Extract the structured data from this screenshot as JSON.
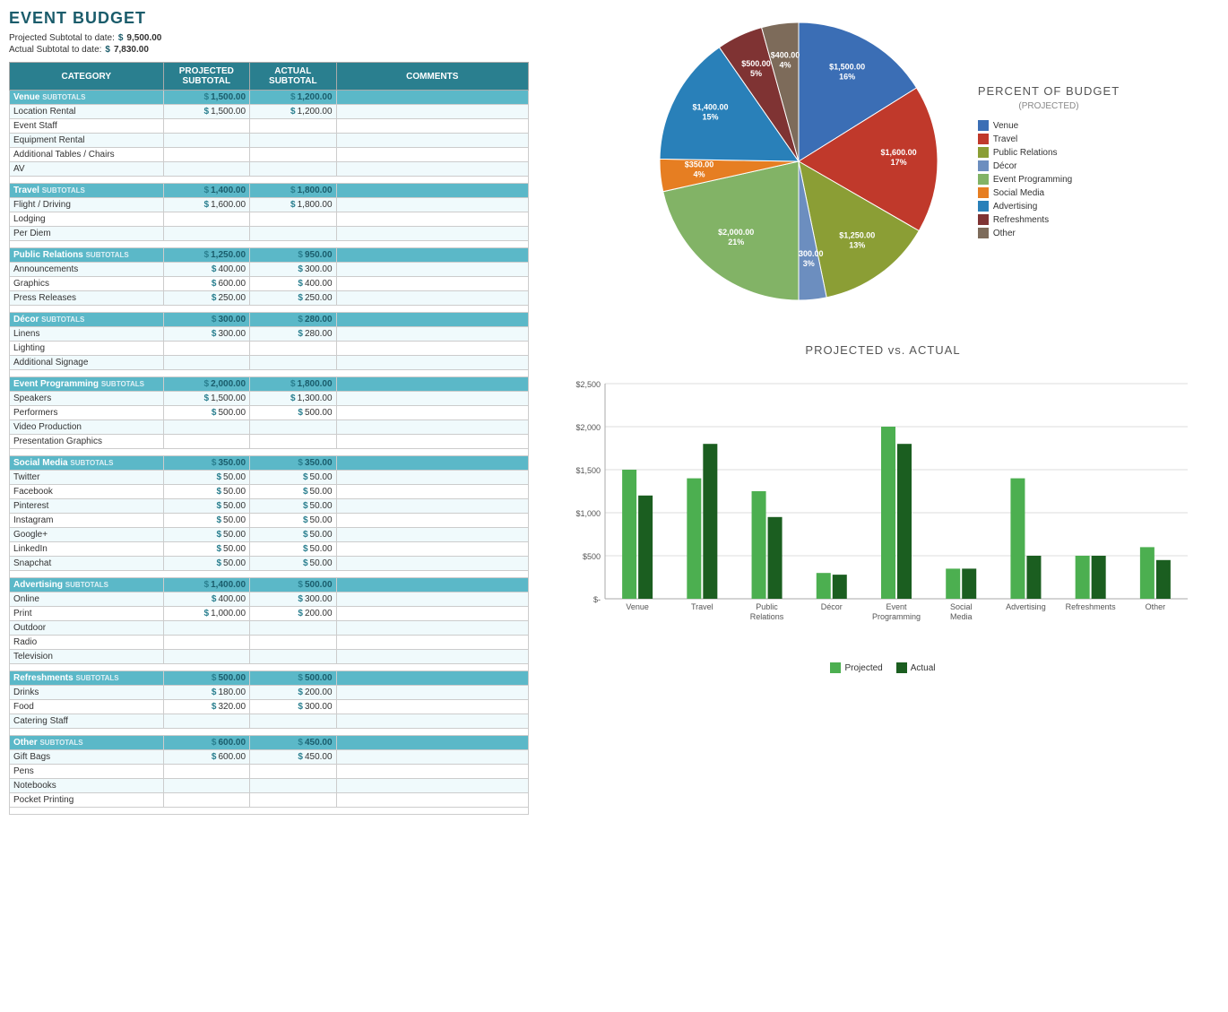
{
  "title": "EVENT BUDGET",
  "summary": {
    "projected_label": "Projected Subtotal to date:",
    "projected_dollar": "$",
    "projected_amount": "9,500.00",
    "actual_label": "Actual Subtotal to date:",
    "actual_dollar": "$",
    "actual_amount": "7,830.00"
  },
  "table": {
    "headers": [
      "CATEGORY",
      "PROJECTED SUBTOTAL",
      "ACTUAL SUBTOTAL",
      "COMMENTS"
    ],
    "categories": [
      {
        "name": "Venue",
        "proj_subtotal": "1,500.00",
        "act_subtotal": "1,200.00",
        "items": [
          {
            "name": "Location Rental",
            "proj": "1,500.00",
            "act": "1,200.00"
          },
          {
            "name": "Event Staff",
            "proj": "",
            "act": ""
          },
          {
            "name": "Equipment Rental",
            "proj": "",
            "act": ""
          },
          {
            "name": "Additional Tables / Chairs",
            "proj": "",
            "act": ""
          },
          {
            "name": "AV",
            "proj": "",
            "act": ""
          }
        ]
      },
      {
        "name": "Travel",
        "proj_subtotal": "1,400.00",
        "act_subtotal": "1,800.00",
        "items": [
          {
            "name": "Flight / Driving",
            "proj": "1,600.00",
            "act": "1,800.00"
          },
          {
            "name": "Lodging",
            "proj": "",
            "act": ""
          },
          {
            "name": "Per Diem",
            "proj": "",
            "act": ""
          }
        ]
      },
      {
        "name": "Public Relations",
        "proj_subtotal": "1,250.00",
        "act_subtotal": "950.00",
        "items": [
          {
            "name": "Announcements",
            "proj": "400.00",
            "act": "300.00"
          },
          {
            "name": "Graphics",
            "proj": "600.00",
            "act": "400.00"
          },
          {
            "name": "Press Releases",
            "proj": "250.00",
            "act": "250.00"
          }
        ]
      },
      {
        "name": "Décor",
        "proj_subtotal": "300.00",
        "act_subtotal": "280.00",
        "items": [
          {
            "name": "Linens",
            "proj": "300.00",
            "act": "280.00"
          },
          {
            "name": "Lighting",
            "proj": "",
            "act": ""
          },
          {
            "name": "Additional Signage",
            "proj": "",
            "act": ""
          }
        ]
      },
      {
        "name": "Event Programming",
        "proj_subtotal": "2,000.00",
        "act_subtotal": "1,800.00",
        "items": [
          {
            "name": "Speakers",
            "proj": "1,500.00",
            "act": "1,300.00"
          },
          {
            "name": "Performers",
            "proj": "500.00",
            "act": "500.00"
          },
          {
            "name": "Video Production",
            "proj": "",
            "act": ""
          },
          {
            "name": "Presentation Graphics",
            "proj": "",
            "act": ""
          }
        ]
      },
      {
        "name": "Social Media",
        "proj_subtotal": "350.00",
        "act_subtotal": "350.00",
        "items": [
          {
            "name": "Twitter",
            "proj": "50.00",
            "act": "50.00"
          },
          {
            "name": "Facebook",
            "proj": "50.00",
            "act": "50.00"
          },
          {
            "name": "Pinterest",
            "proj": "50.00",
            "act": "50.00"
          },
          {
            "name": "Instagram",
            "proj": "50.00",
            "act": "50.00"
          },
          {
            "name": "Google+",
            "proj": "50.00",
            "act": "50.00"
          },
          {
            "name": "LinkedIn",
            "proj": "50.00",
            "act": "50.00"
          },
          {
            "name": "Snapchat",
            "proj": "50.00",
            "act": "50.00"
          }
        ]
      },
      {
        "name": "Advertising",
        "proj_subtotal": "1,400.00",
        "act_subtotal": "500.00",
        "items": [
          {
            "name": "Online",
            "proj": "400.00",
            "act": "300.00"
          },
          {
            "name": "Print",
            "proj": "1,000.00",
            "act": "200.00"
          },
          {
            "name": "Outdoor",
            "proj": "",
            "act": ""
          },
          {
            "name": "Radio",
            "proj": "",
            "act": ""
          },
          {
            "name": "Television",
            "proj": "",
            "act": ""
          }
        ]
      },
      {
        "name": "Refreshments",
        "proj_subtotal": "500.00",
        "act_subtotal": "500.00",
        "items": [
          {
            "name": "Drinks",
            "proj": "180.00",
            "act": "200.00"
          },
          {
            "name": "Food",
            "proj": "320.00",
            "act": "300.00"
          },
          {
            "name": "Catering Staff",
            "proj": "",
            "act": ""
          }
        ]
      },
      {
        "name": "Other",
        "proj_subtotal": "600.00",
        "act_subtotal": "450.00",
        "items": [
          {
            "name": "Gift Bags",
            "proj": "600.00",
            "act": "450.00"
          },
          {
            "name": "Pens",
            "proj": "",
            "act": ""
          },
          {
            "name": "Notebooks",
            "proj": "",
            "act": ""
          },
          {
            "name": "Pocket Printing",
            "proj": "",
            "act": ""
          }
        ]
      }
    ]
  },
  "pie_chart": {
    "title": "PERCENT OF BUDGET",
    "subtitle": "(PROJECTED)",
    "slices": [
      {
        "label": "Venue",
        "value": 1500,
        "percent": 16,
        "color": "#3b6eb5",
        "annotation": "$1,500.00\n16%"
      },
      {
        "label": "Travel",
        "value": 1600,
        "percent": 17,
        "color": "#c0392b",
        "annotation": "$1,600.00\n17%"
      },
      {
        "label": "Public Relations",
        "value": 1250,
        "percent": 13,
        "color": "#8b9e35",
        "annotation": "$1,250.00\n13%"
      },
      {
        "label": "Décor",
        "value": 300,
        "percent": 3,
        "color": "#6c8ebf",
        "annotation": "$300.00\n3%"
      },
      {
        "label": "Event Programming",
        "value": 2000,
        "percent": 21,
        "color": "#82b366",
        "annotation": "$2,000.00\n21%"
      },
      {
        "label": "Social Media",
        "value": 350,
        "percent": 4,
        "color": "#e67e22",
        "annotation": "$350.00\n4%"
      },
      {
        "label": "Advertising",
        "value": 1400,
        "percent": 15,
        "color": "#2980b9",
        "annotation": "$1,400.00\n15%"
      },
      {
        "label": "Refreshments",
        "value": 500,
        "percent": 5,
        "color": "#7f3333",
        "annotation": "$500.00\n5%"
      },
      {
        "label": "Other",
        "value": 400,
        "percent": 4,
        "color": "#7d6b5a",
        "annotation": "$400.00\n4%"
      }
    ],
    "legend": [
      {
        "label": "Venue",
        "color": "#3b6eb5"
      },
      {
        "label": "Travel",
        "color": "#c0392b"
      },
      {
        "label": "Public Relations",
        "color": "#8b9e35"
      },
      {
        "label": "Décor",
        "color": "#6c8ebf"
      },
      {
        "label": "Event Programming",
        "color": "#82b366"
      },
      {
        "label": "Social Media",
        "color": "#e67e22"
      },
      {
        "label": "Advertising",
        "color": "#2980b9"
      },
      {
        "label": "Refreshments",
        "color": "#7f3333"
      },
      {
        "label": "Other",
        "color": "#7d6b5a"
      }
    ]
  },
  "bar_chart": {
    "title": "PROJECTED vs. ACTUAL",
    "y_labels": [
      "$-",
      "$500",
      "$1,000",
      "$1,500",
      "$2,000",
      "$2,500"
    ],
    "max_value": 2500,
    "groups": [
      {
        "label": "Venue",
        "projected": 1500,
        "actual": 1200
      },
      {
        "label": "Travel",
        "projected": 1400,
        "actual": 1800
      },
      {
        "label": "Public Relations",
        "projected": 1250,
        "actual": 950
      },
      {
        "label": "Décor",
        "projected": 300,
        "actual": 280
      },
      {
        "label": "Event Programming",
        "projected": 2000,
        "actual": 1800
      },
      {
        "label": "Social Media",
        "projected": 350,
        "actual": 350
      },
      {
        "label": "Advertising",
        "projected": 1400,
        "actual": 500
      },
      {
        "label": "Refreshments",
        "projected": 500,
        "actual": 500
      },
      {
        "label": "Other",
        "projected": 600,
        "actual": 450
      }
    ],
    "projected_color": "#4caf50",
    "actual_color": "#1b5e20",
    "legend": [
      {
        "label": "Projected",
        "color": "#4caf50"
      },
      {
        "label": "Actual",
        "color": "#1b5e20"
      }
    ]
  }
}
